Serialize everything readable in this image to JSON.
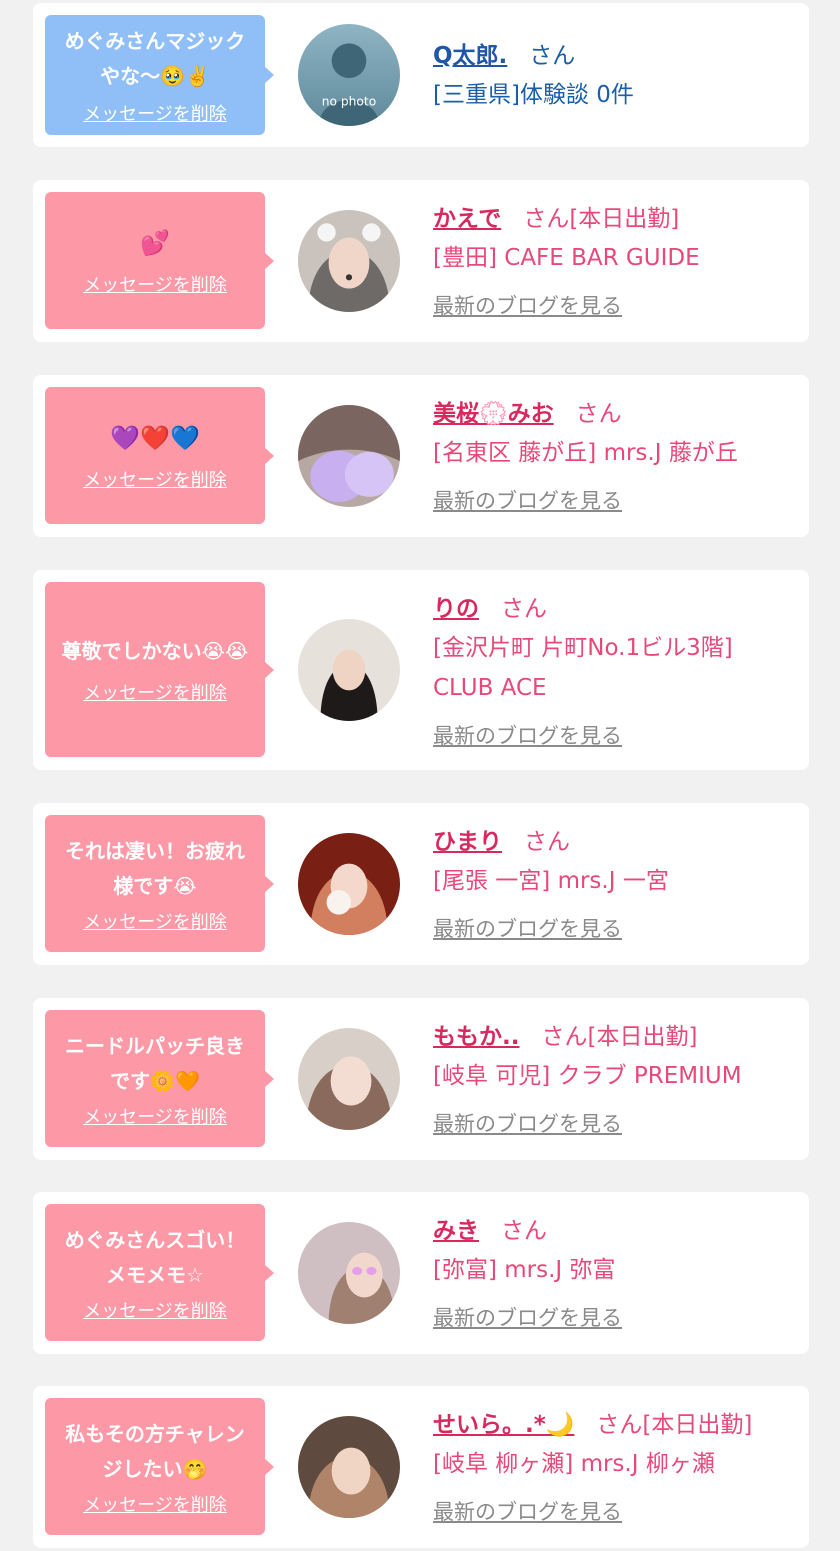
{
  "colors": {
    "card_bg": "#ffffff",
    "page_bg": "#f1f1f1",
    "bubble_pink": "#fd98a6",
    "bubble_blue": "#90bff8",
    "name_pink": "#d8295f",
    "text_pink": "#e8487a",
    "name_blue": "#1e56a8",
    "text_blue": "#1a5fa8",
    "blog_link": "#8a8a8a"
  },
  "common": {
    "delete_label": "メッセージを削除",
    "blog_label": "最新のブログを見る"
  },
  "messages": [
    {
      "bubble_color": "blue",
      "message": "めぐみさんマジックやな〜🥹✌️",
      "avatar": "no-photo-avatar",
      "avatar_text": "no photo",
      "name": "Q太郎.",
      "suffix": "さん",
      "shop": "[三重県]体験談 0件",
      "has_blog": false
    },
    {
      "bubble_color": "pink",
      "message": "💕",
      "avatar": "girl-photo-avatar",
      "name": "かえで",
      "suffix": "さん[本日出勤]",
      "shop": "[豊田] CAFE BAR GUIDE",
      "has_blog": true
    },
    {
      "bubble_color": "pink",
      "message": "💜❤️💙",
      "avatar": "girl-photo-avatar",
      "name": "美桜💮みお",
      "suffix": "さん",
      "shop": "[名東区 藤が丘] mrs.J 藤が丘",
      "has_blog": true
    },
    {
      "bubble_color": "pink",
      "message": "尊敬でしかない😭😭",
      "avatar": "girl-photo-avatar",
      "name": "りの",
      "suffix": "さん",
      "shop": "[金沢片町 片町No.1ビル3階] CLUB ACE",
      "has_blog": true
    },
    {
      "bubble_color": "pink",
      "message": "それは凄い！お疲れ様です😭",
      "avatar": "girl-photo-avatar",
      "name": "ひまり",
      "suffix": "さん",
      "shop": "[尾張 一宮] mrs.J 一宮",
      "has_blog": true
    },
    {
      "bubble_color": "pink",
      "message": "ニードルパッチ良きです🌼🧡",
      "avatar": "girl-photo-avatar",
      "name": "ももか..",
      "suffix": "さん[本日出勤]",
      "shop": "[岐阜 可児] クラブ PREMIUM",
      "has_blog": true
    },
    {
      "bubble_color": "pink",
      "message": "めぐみさんスゴい！メモメモ☆",
      "avatar": "girl-photo-avatar",
      "name": "みき",
      "suffix": "さん",
      "shop": "[弥富] mrs.J 弥富",
      "has_blog": true
    },
    {
      "bubble_color": "pink",
      "message": "私もその方チャレンジしたい🤭",
      "avatar": "girl-photo-avatar",
      "name": "せいら。.*🌙",
      "suffix": "さん[本日出勤]",
      "shop": "[岐阜 柳ヶ瀬] mrs.J 柳ヶ瀬",
      "has_blog": true
    }
  ]
}
